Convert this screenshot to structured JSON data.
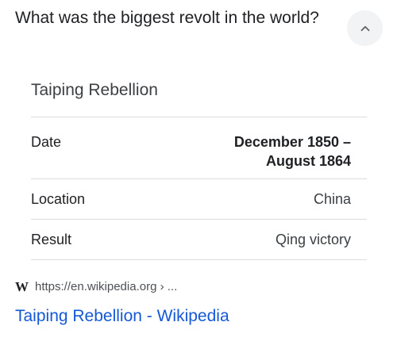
{
  "question": "What was the biggest revolt in the world?",
  "collapse_icon": "chevron-up-icon",
  "card": {
    "title": "Taiping Rebellion",
    "rows": [
      {
        "label": "Date",
        "value_line1": "December 1850 –",
        "value_line2": "August 1864"
      },
      {
        "label": "Location",
        "value": "China"
      },
      {
        "label": "Result",
        "value": "Qing victory"
      }
    ]
  },
  "source": {
    "icon_text": "W",
    "url": "https://en.wikipedia.org › ..."
  },
  "link": {
    "text": "Taiping Rebellion - Wikipedia",
    "color": "#1558d6"
  }
}
